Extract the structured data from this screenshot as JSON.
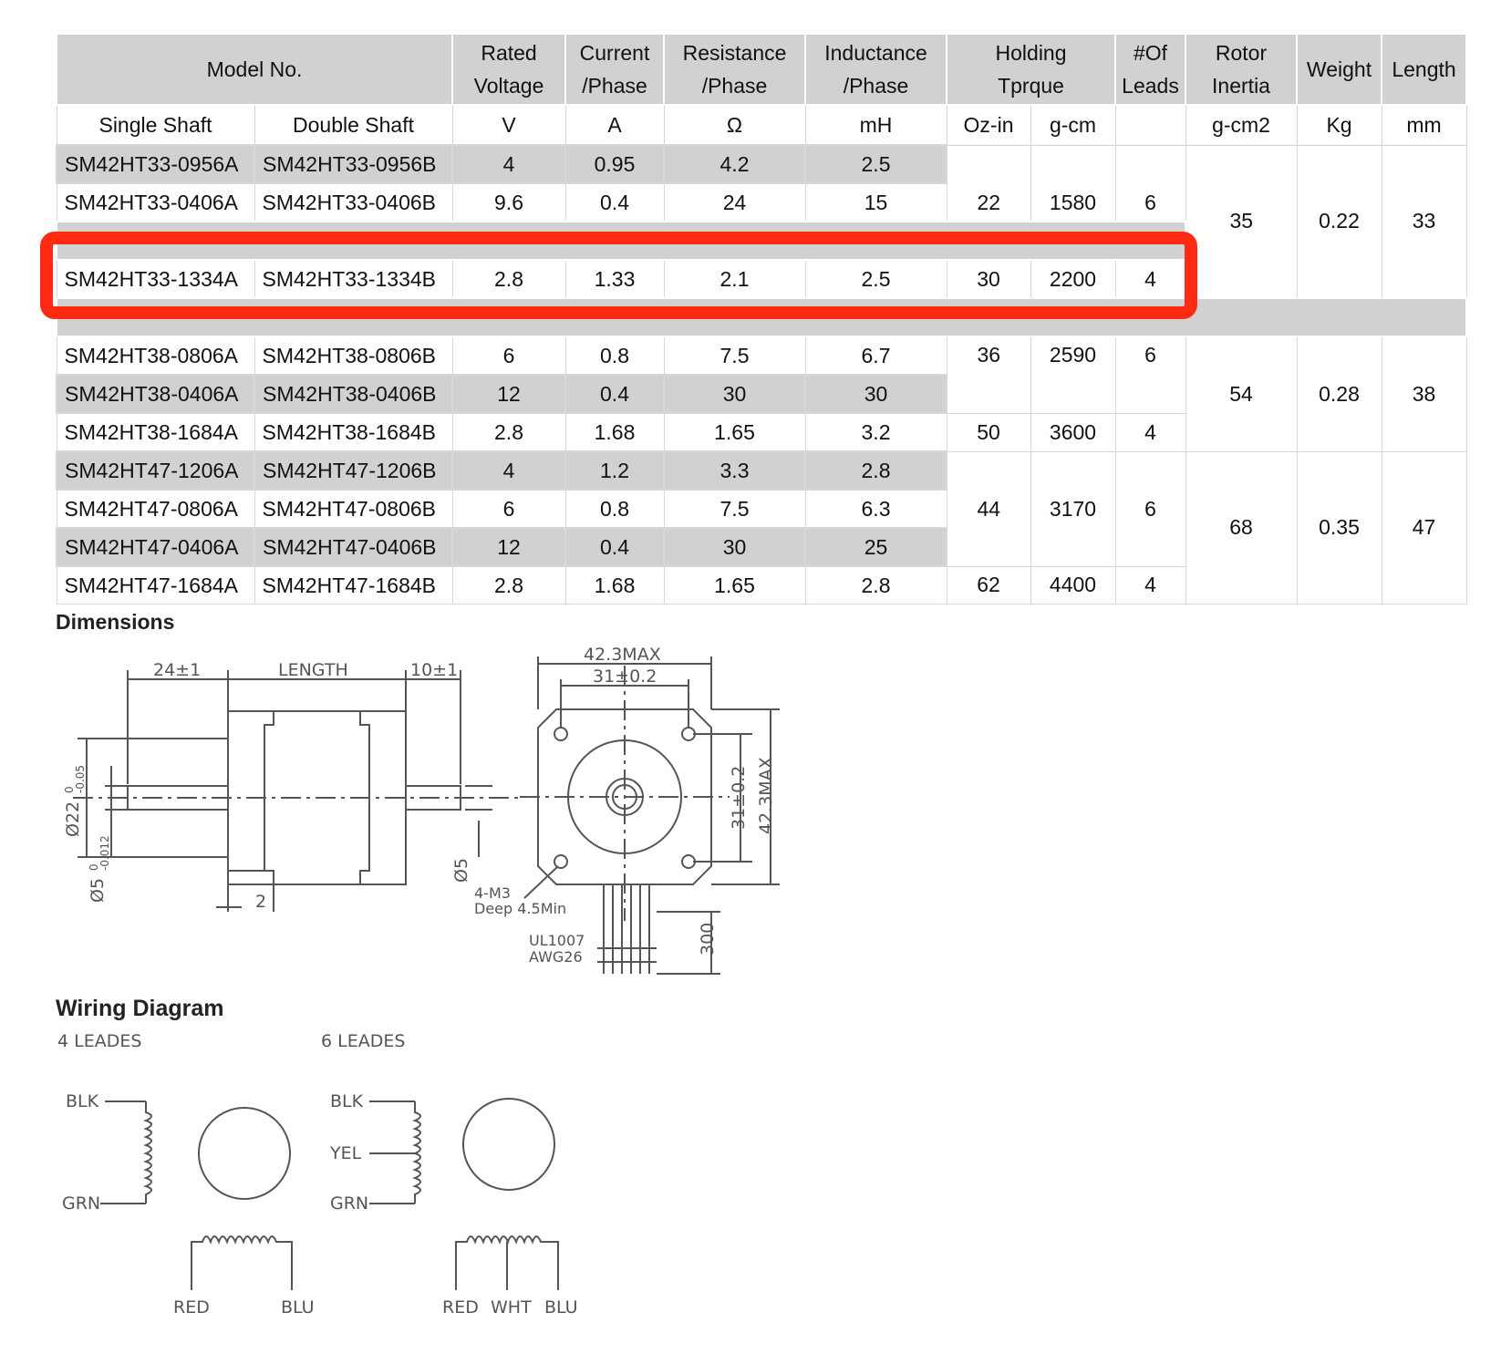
{
  "table": {
    "header_top": {
      "model_no": "Model No.",
      "rated_voltage": [
        "Rated",
        "Voltage"
      ],
      "current_phase": [
        "Current",
        "/Phase"
      ],
      "resistance_phase": [
        "Resistance",
        "/Phase"
      ],
      "inductance_phase": [
        "Inductance",
        "/Phase"
      ],
      "holding_torque": [
        "Holding",
        "Tprque"
      ],
      "num_leads": [
        "#Of",
        "Leads"
      ],
      "rotor_inertia": [
        "Rotor",
        "Inertia"
      ],
      "weight": "Weight",
      "length": "Length"
    },
    "header_sub": {
      "single_shaft": "Single Shaft",
      "double_shaft": "Double Shaft",
      "voltage_unit": "V",
      "current_unit": "A",
      "resistance_unit": "Ω",
      "inductance_unit": "mH",
      "torque_oz": "Oz-in",
      "torque_gcm": "g-cm",
      "leads_unit": "",
      "inertia_unit": "g-cm2",
      "weight_unit": "Kg",
      "length_unit": "mm"
    },
    "rows": [
      {
        "single": "SM42HT33-0956A",
        "double": "SM42HT33-0956B",
        "v": "4",
        "a": "0.95",
        "ohm": "4.2",
        "mh": "2.5"
      },
      {
        "single": "SM42HT33-0406A",
        "double": "SM42HT33-0406B",
        "v": "9.6",
        "a": "0.4",
        "ohm": "24",
        "mh": "15"
      },
      {
        "single": "SM42HT33-1334A",
        "double": "SM42HT33-1334B",
        "v": "2.8",
        "a": "1.33",
        "ohm": "2.1",
        "mh": "2.5"
      },
      {
        "single": "SM42HT38-0806A",
        "double": "SM42HT38-0806B",
        "v": "6",
        "a": "0.8",
        "ohm": "7.5",
        "mh": "6.7"
      },
      {
        "single": "SM42HT38-0406A",
        "double": "SM42HT38-0406B",
        "v": "12",
        "a": "0.4",
        "ohm": "30",
        "mh": "30"
      },
      {
        "single": "SM42HT38-1684A",
        "double": "SM42HT38-1684B",
        "v": "2.8",
        "a": "1.68",
        "ohm": "1.65",
        "mh": "3.2"
      },
      {
        "single": "SM42HT47-1206A",
        "double": "SM42HT47-1206B",
        "v": "4",
        "a": "1.2",
        "ohm": "3.3",
        "mh": "2.8"
      },
      {
        "single": "SM42HT47-0806A",
        "double": "SM42HT47-0806B",
        "v": "6",
        "a": "0.8",
        "ohm": "7.5",
        "mh": "6.3"
      },
      {
        "single": "SM42HT47-0406A",
        "double": "SM42HT47-0406B",
        "v": "12",
        "a": "0.4",
        "ohm": "30",
        "mh": "25"
      },
      {
        "single": "SM42HT47-1684A",
        "double": "SM42HT47-1684B",
        "v": "2.8",
        "a": "1.68",
        "ohm": "1.65",
        "mh": "2.8"
      }
    ],
    "torque_groups": [
      {
        "oz": "22",
        "gcm": "1580",
        "leads": "6"
      },
      {
        "oz": "30",
        "gcm": "2200",
        "leads": "4"
      },
      {
        "oz": "36",
        "gcm": "2590",
        "leads": "6"
      },
      {
        "oz": "50",
        "gcm": "3600",
        "leads": "4"
      },
      {
        "oz": "44",
        "gcm": "3170",
        "leads": "6"
      },
      {
        "oz": "62",
        "gcm": "4400",
        "leads": "4"
      }
    ],
    "frame_groups": [
      {
        "inertia": "35",
        "weight": "0.22",
        "length": "33"
      },
      {
        "inertia": "54",
        "weight": "0.28",
        "length": "38"
      },
      {
        "inertia": "68",
        "weight": "0.35",
        "length": "47"
      }
    ],
    "highlight_color": "#ff2a12"
  },
  "dimensions": {
    "title": "Dimensions",
    "labels": {
      "shaft_len": "24±1",
      "length": "LENGTH",
      "rear_shaft": "10±1",
      "max_width": "42.3MAX",
      "hole_spacing": "31±0.2",
      "hole_spacing_v": "31±0.2",
      "max_height_v": "42.3MAX",
      "boss_dia": "Ø22",
      "boss_tol_upper": "0",
      "boss_tol_lower": "-0.05",
      "shaft_dia": "Ø5",
      "shaft_tol_upper": "0",
      "shaft_tol_lower": "-0.012",
      "rear_shaft_dia": "Ø5",
      "flange": "2",
      "screw": "4-M3",
      "screw_depth": "Deep 4.5Min",
      "wire_type": "UL1007",
      "wire_gauge": "AWG26",
      "wire_len": "300"
    }
  },
  "wiring": {
    "title": "Wiring Diagram",
    "four": {
      "caption": "4 LEADES",
      "blk": "BLK",
      "grn": "GRN",
      "red": "RED",
      "blu": "BLU"
    },
    "six": {
      "caption": "6 LEADES",
      "blk": "BLK",
      "yel": "YEL",
      "grn": "GRN",
      "red": "RED",
      "wht": "WHT",
      "blu": "BLU"
    }
  }
}
